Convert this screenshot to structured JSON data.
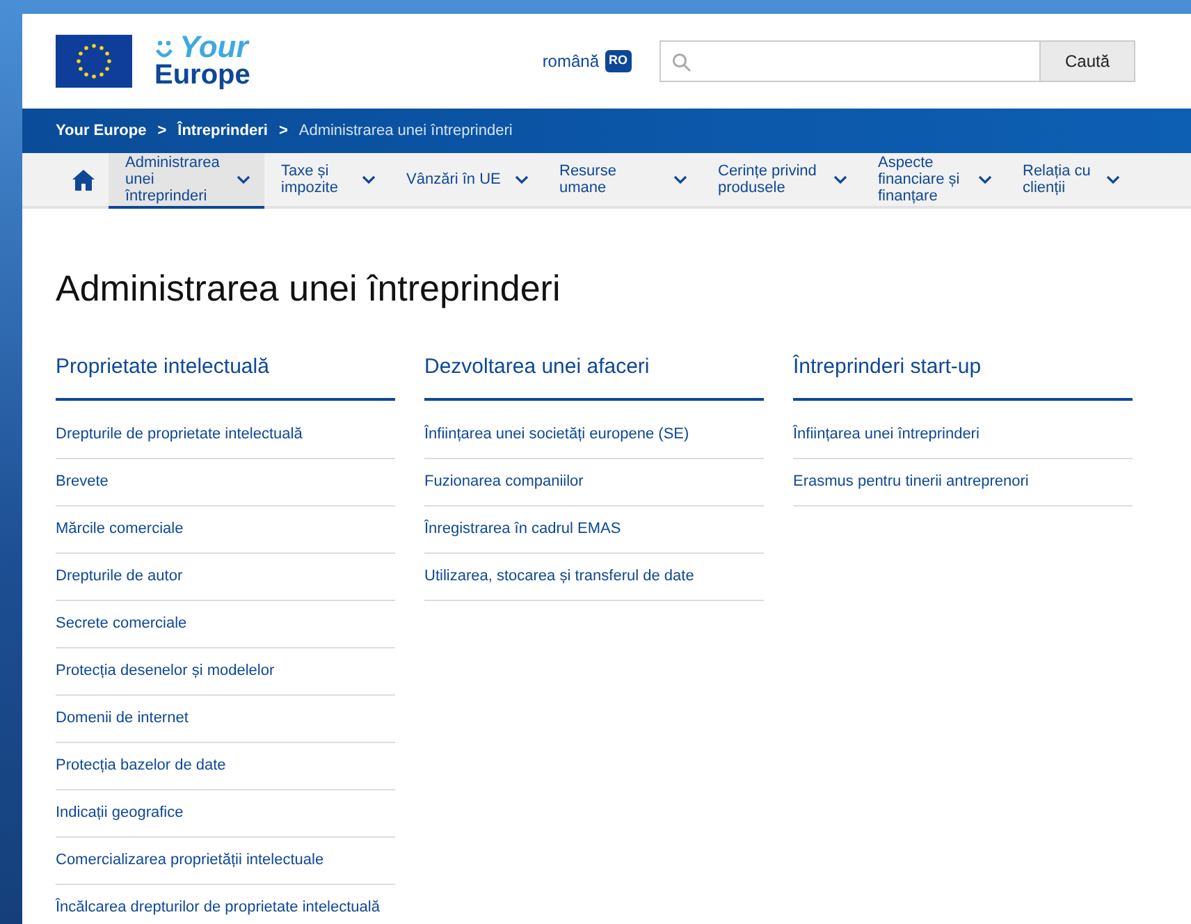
{
  "header": {
    "logo": {
      "line_1": "Your",
      "line_2": "Europe"
    },
    "language": {
      "name": "română",
      "code": "RO"
    },
    "search": {
      "button": "Caută"
    }
  },
  "breadcrumb": [
    {
      "label": "Your Europe",
      "current": false
    },
    {
      "label": "Întreprinderi",
      "current": false
    },
    {
      "label": "Administrarea unei întreprinderi",
      "current": true
    }
  ],
  "breadcrumb_separator": ">",
  "nav": [
    {
      "label": "Administrarea unei întreprinderi",
      "selected": true
    },
    {
      "label": "Taxe și impozite",
      "selected": false
    },
    {
      "label": "Vânzări în UE",
      "selected": false
    },
    {
      "label": "Resurse umane",
      "selected": false
    },
    {
      "label": "Cerințe privind produsele",
      "selected": false
    },
    {
      "label": "Aspecte financiare și finanțare",
      "selected": false
    },
    {
      "label": "Relația cu clienții",
      "selected": false
    }
  ],
  "page_title": "Administrarea unei întreprinderi",
  "sections": [
    {
      "title": "Proprietate intelectuală",
      "links": [
        "Drepturile de proprietate intelectuală",
        "Brevete",
        "Mărcile comerciale",
        "Drepturile de autor",
        "Secrete comerciale",
        "Protecția desenelor și modelelor",
        "Domenii de internet",
        "Protecția bazelor de date",
        "Indicații geografice",
        "Comercializarea proprietății intelectuale",
        "Încălcarea drepturilor de proprietate intelectuală"
      ]
    },
    {
      "title": "Dezvoltarea unei afaceri",
      "links": [
        "Înființarea unei societăți europene (SE)",
        "Fuzionarea companiilor",
        "Înregistrarea în cadrul EMAS",
        "Utilizarea, stocarea și transferul de date"
      ]
    },
    {
      "title": "Întreprinderi start-up",
      "links": [
        "Înființarea unei întreprinderi",
        "Erasmus pentru tinerii antreprenori"
      ]
    }
  ]
}
